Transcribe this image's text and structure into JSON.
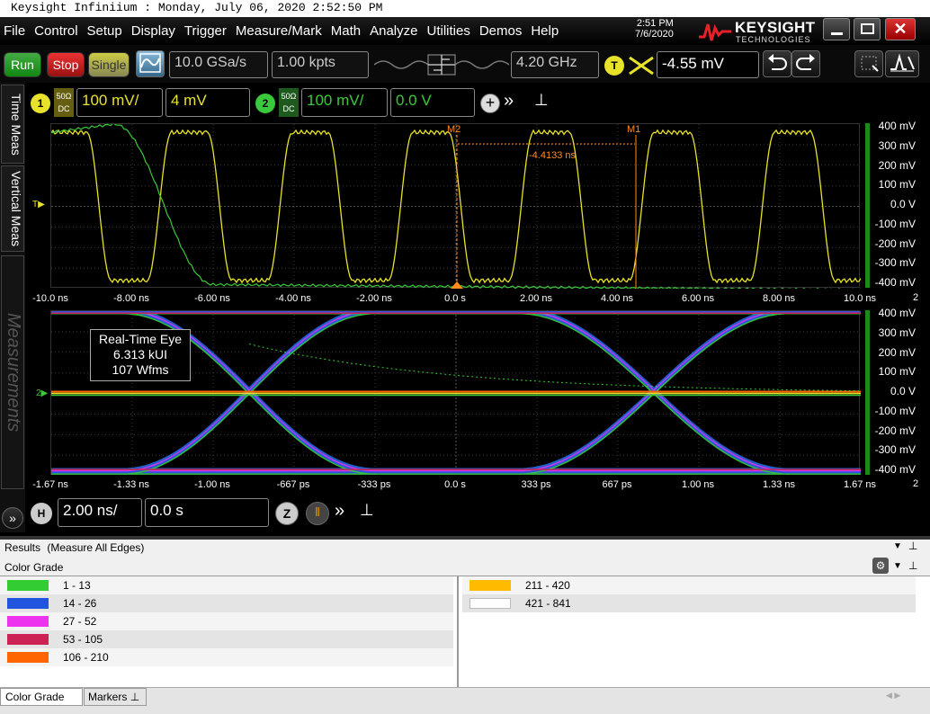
{
  "window_title": "Keysight Infiniium : Monday, July 06, 2020 2:52:50 PM",
  "menu": [
    "File",
    "Control",
    "Setup",
    "Display",
    "Trigger",
    "Measure/Mark",
    "Math",
    "Analyze",
    "Utilities",
    "Demos",
    "Help"
  ],
  "clock": {
    "time": "2:51 PM",
    "date": "7/6/2020"
  },
  "brand": {
    "name": "KEYSIGHT",
    "sub": "TECHNOLOGIES"
  },
  "toolbar": {
    "run": "Run",
    "stop": "Stop",
    "single": "Single",
    "sample_rate": "10.0 GSa/s",
    "points": "1.00 kpts",
    "bandwidth": "4.20 GHz",
    "trigger_badge": "T",
    "trigger_level": "-4.55 mV"
  },
  "channels": {
    "ch1": {
      "num": "1",
      "imp": "50Ω",
      "cpl": "DC",
      "scale": "100 mV/",
      "offset": "4 mV",
      "color": "#e8e22a"
    },
    "ch2": {
      "num": "2",
      "imp": "50Ω",
      "cpl": "DC",
      "scale": "100 mV/",
      "offset": "0.0 V",
      "color": "#3ac93a"
    }
  },
  "side_tabs": [
    "Time Meas",
    "Vertical Meas",
    "Measurements"
  ],
  "upper_plot": {
    "markers": {
      "m2": "M2",
      "m1": "M1",
      "delta": "-4.4133 ns"
    },
    "y_labels": [
      "400 mV",
      "300 mV",
      "200 mV",
      "100 mV",
      "0.0 V",
      "-100 mV",
      "-200 mV",
      "-300 mV",
      "-400 mV"
    ],
    "x_labels": [
      "-10.0 ns",
      "-8.00 ns",
      "-6.00 ns",
      "-4.00 ns",
      "-2.00 ns",
      "0.0 s",
      "2.00 ns",
      "4.00 ns",
      "6.00 ns",
      "8.00 ns",
      "10.0 ns"
    ],
    "corner_label": "2"
  },
  "lower_plot": {
    "eye_title": "Real-Time Eye",
    "eye_ui": "6.313 kUI",
    "eye_wfms": "107 Wfms",
    "y_labels": [
      "400 mV",
      "300 mV",
      "200 mV",
      "100 mV",
      "0.0 V",
      "-100 mV",
      "-200 mV",
      "-300 mV",
      "-400 mV"
    ],
    "x_labels": [
      "-1.67 ns",
      "-1.33 ns",
      "-1.00 ns",
      "-667 ps",
      "-333 ps",
      "0.0 s",
      "333 ps",
      "667 ps",
      "1.00 ns",
      "1.33 ns",
      "1.67 ns"
    ],
    "corner_label": "2"
  },
  "horizontal": {
    "badge": "H",
    "scale": "2.00 ns/",
    "position": "0.0 s"
  },
  "results": {
    "title": "Results",
    "subtitle": "(Measure All Edges)",
    "section": "Color Grade",
    "legend_left": [
      {
        "range": "1 - 13",
        "color": "#33cc33"
      },
      {
        "range": "14 - 26",
        "color": "#2255dd"
      },
      {
        "range": "27 - 52",
        "color": "#ee33ee"
      },
      {
        "range": "53 - 105",
        "color": "#cc2255"
      },
      {
        "range": "106 - 210",
        "color": "#ff6600"
      }
    ],
    "legend_right": [
      {
        "range": "211 - 420",
        "color": "#ffbb00"
      },
      {
        "range": "421 - 841",
        "color": "#ffffff"
      }
    ],
    "bottom_tabs": [
      "Color Grade",
      "Markers"
    ]
  }
}
